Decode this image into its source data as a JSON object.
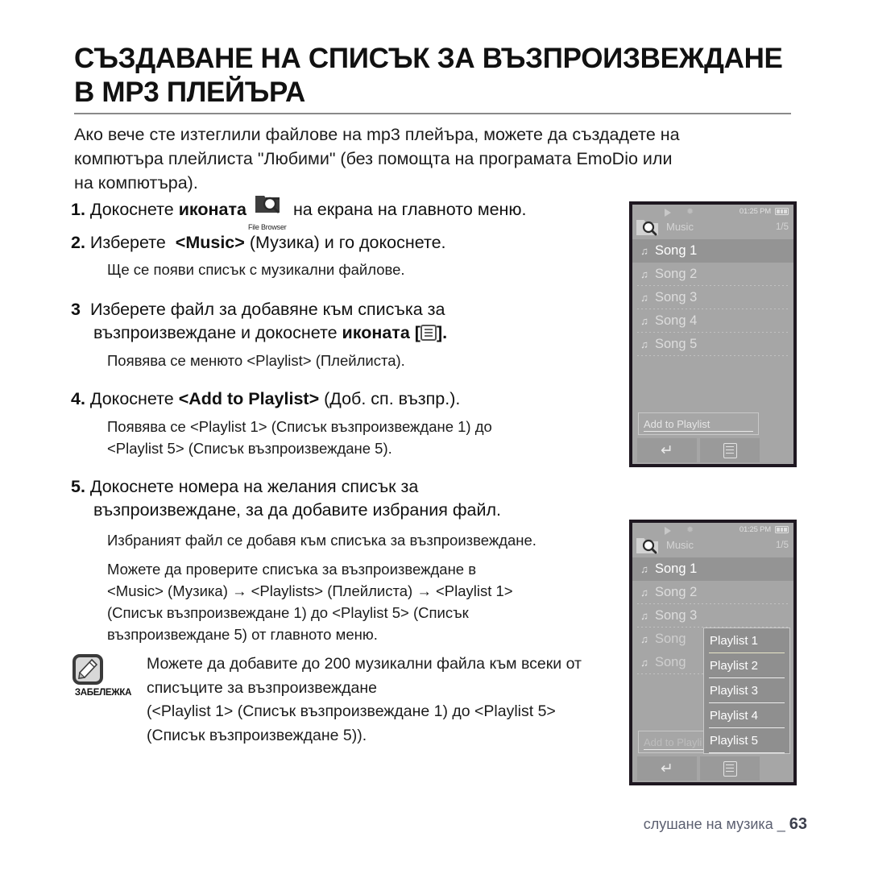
{
  "document": {
    "title_lines": [
      "СЪЗДАВАНЕ НА СПИСЪК ЗА ВЪЗПРОИЗВЕЖДАНЕ",
      "В MP3 ПЛЕЙЪРА"
    ],
    "intro_lines": [
      "Ако вече сте изтеглили файлове на mp3 плейъра, можете да създадете на",
      "компютъра плейлиста \"Любими\" (без помощта на програмата EmoDio или",
      "на компютъра)."
    ],
    "footer": {
      "text": "слушане на музика _",
      "page": "63"
    }
  },
  "steps": [
    {
      "number": "1.",
      "text_before": "Докоснете",
      "bold_word": "иконата",
      "icon": "file-browser-icon",
      "icon_caption": "File Browser",
      "text_after": "на екрана на главното меню.",
      "sub": []
    },
    {
      "number": "2.",
      "text_before": "Изберете",
      "bold_word": "<Music>",
      "text_after": "(Музика) и го докоснете.",
      "sub": [
        "Ще се появи списък с музикални файлове."
      ]
    },
    {
      "number": "3",
      "line1": "Изберете файл за добавяне към списъка за",
      "line2_before": "възпроизвеждане и докоснете",
      "line2_bold": "иконата",
      "line2_icon": "menu-icon",
      "sub": [
        "Появява се менюто <Playlist> (Плейлиста)."
      ]
    },
    {
      "number": "4.",
      "text_before": "Докоснете",
      "bold_word": "<Add to Playlist>",
      "text_after": "(Доб. сп. възпр.).",
      "sub": [
        "Появява се <Playlist 1> (Списък възпроизвеждане 1) до",
        "<Playlist 5> (Списък възпроизвеждане 5)."
      ]
    },
    {
      "number": "5.",
      "line1": "Докоснете номера на желания списък за",
      "line2": "възпроизвеждане, за да добавите избрания файл.",
      "sub": [
        "Избраният файл се добавя към списъка за възпроизвеждане.",
        "Можете да проверите списъка за възпроизвеждане в",
        "<Music> (Музика) → <Playlists> (Плейлиста) → <Playlist 1>",
        "(Списък възпроизвеждане 1) до <Playlist 5> (Списък",
        "възпроизвеждане 5) от главното меню."
      ]
    }
  ],
  "note": {
    "label": "ЗАБЕЛЕЖКА",
    "icon": "note-pen-icon",
    "lines": [
      "Можете да добавите до 200 музикални файла към всеки от",
      "списъците за възпроизвеждане",
      "(<Playlist 1> (Списък възпроизвеждане 1) до <Playlist 5>",
      "(Списък възпроизвеждане 5))."
    ]
  },
  "devices": [
    {
      "id": "device-music-list",
      "statusbar": {
        "play_icon": "play-icon",
        "bluetooth_icon": "bluetooth-icon",
        "time": "01:25 PM",
        "battery_icon": "battery-full-icon"
      },
      "header": {
        "folder_icon": "file-browser-folder-icon",
        "title": "Music",
        "count": "1/5"
      },
      "songs": [
        {
          "label": "Song 1",
          "selected": true
        },
        {
          "label": "Song 2",
          "selected": false
        },
        {
          "label": "Song 3",
          "selected": false
        },
        {
          "label": "Song 4",
          "selected": false
        },
        {
          "label": "Song 5",
          "selected": false
        }
      ],
      "add_bar": "Add to Playlist",
      "softkeys": [
        {
          "icon": "back-arrow-icon"
        },
        {
          "icon": "menu-list-icon"
        }
      ]
    },
    {
      "id": "device-playlist-popup",
      "statusbar": {
        "play_icon": "play-icon",
        "bluetooth_icon": "bluetooth-icon",
        "time": "01:25 PM",
        "battery_icon": "battery-full-icon"
      },
      "header": {
        "folder_icon": "file-browser-folder-icon",
        "title": "Music",
        "count": "1/5"
      },
      "songs": [
        {
          "label": "Song 1",
          "selected": true
        },
        {
          "label": "Song 2",
          "selected": false
        },
        {
          "label": "Song 3",
          "selected": false
        },
        {
          "label": "Song",
          "selected": false
        },
        {
          "label": "Song",
          "selected": false
        }
      ],
      "add_bar": "Add to Playli",
      "popup": [
        "Playlist 1",
        "Playlist 2",
        "Playlist 3",
        "Playlist 4",
        "Playlist 5"
      ],
      "softkeys": [
        {
          "icon": "back-arrow-icon"
        },
        {
          "icon": "menu-list-icon"
        }
      ]
    }
  ],
  "colors": {
    "screen_bg": "#a6a6a6",
    "screen_border": "#1e1720",
    "selected_row": "#949494",
    "footer_text": "#5b5f70"
  }
}
